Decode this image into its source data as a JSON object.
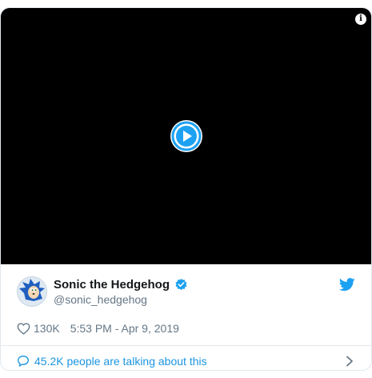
{
  "tweet": {
    "author_name": "Sonic the Hedgehog",
    "handle": "@sonic_hedgehog",
    "likes": "130K",
    "timestamp": "5:53 PM - Apr 9, 2019",
    "conversation": "45.2K people are talking about this"
  },
  "icons": {
    "info": "info-icon",
    "play": "play-icon",
    "verified": "verified-badge-icon",
    "brand": "twitter-bird-icon",
    "like": "heart-icon",
    "reply": "comment-bubble-icon",
    "more": "chevron-right-icon"
  },
  "colors": {
    "accent": "#1da1f2",
    "link": "#1b95e0",
    "muted": "#657786",
    "video_bg": "#000000"
  }
}
